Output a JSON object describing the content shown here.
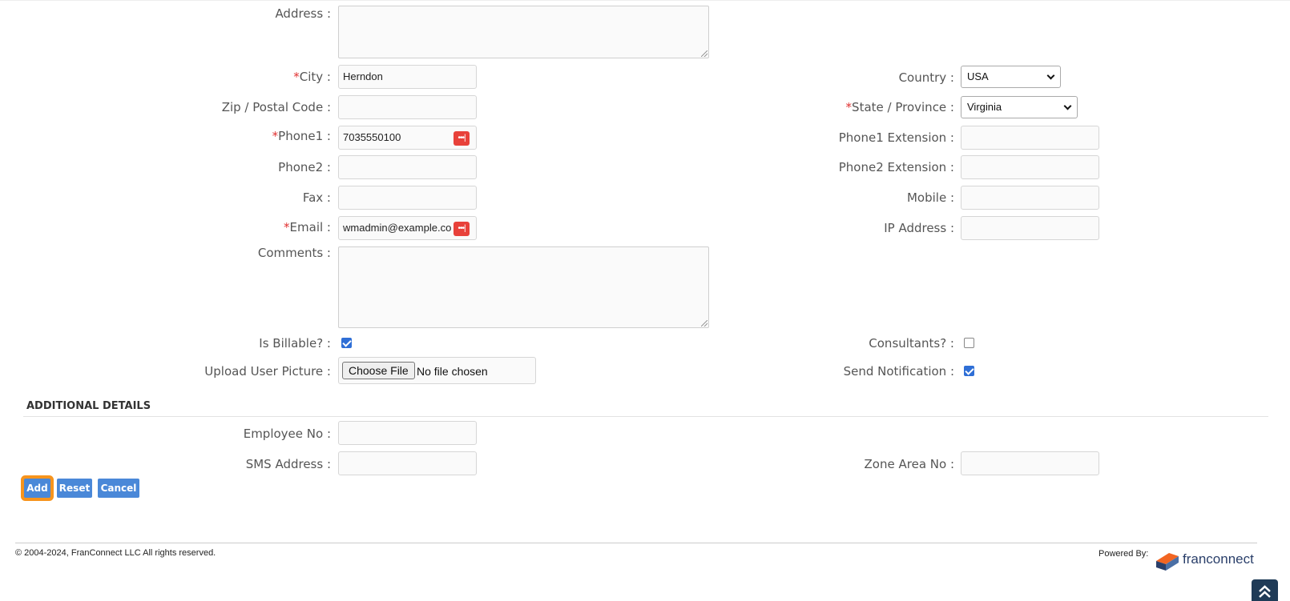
{
  "form": {
    "address": {
      "label": "Address :",
      "value": ""
    },
    "city": {
      "req": "*",
      "label": "City :",
      "value": "Herndon"
    },
    "country": {
      "label": "Country :",
      "value": "USA"
    },
    "zip": {
      "label": "Zip / Postal Code :",
      "value": ""
    },
    "state": {
      "req": "*",
      "label": "State / Province :",
      "value": "Virginia"
    },
    "phone1": {
      "req": "*",
      "label": "Phone1 :",
      "value": "7035550100"
    },
    "phone1_ext": {
      "label": "Phone1 Extension :",
      "value": ""
    },
    "phone2": {
      "label": "Phone2 :",
      "value": ""
    },
    "phone2_ext": {
      "label": "Phone2 Extension :",
      "value": ""
    },
    "fax": {
      "label": "Fax :",
      "value": ""
    },
    "mobile": {
      "label": "Mobile :",
      "value": ""
    },
    "email": {
      "req": "*",
      "label": "Email :",
      "value": "wmadmin@example.co"
    },
    "ip_address": {
      "label": "IP Address :",
      "value": ""
    },
    "comments": {
      "label": "Comments :",
      "value": ""
    },
    "is_billable": {
      "label": "Is Billable? :",
      "checked": true
    },
    "consultants": {
      "label": "Consultants? :",
      "checked": false
    },
    "upload_picture": {
      "label": "Upload User Picture :",
      "button": "Choose File",
      "status": "No file chosen"
    },
    "send_notification": {
      "label": "Send Notification :",
      "checked": true
    }
  },
  "additional": {
    "title": "ADDITIONAL DETAILS",
    "employee_no": {
      "label": "Employee No :",
      "value": ""
    },
    "sms_address": {
      "label": "SMS Address :",
      "value": ""
    },
    "zone_area_no": {
      "label": "Zone Area No :",
      "value": ""
    }
  },
  "actions": {
    "add": "Add",
    "reset": "Reset",
    "cancel": "Cancel"
  },
  "footer": {
    "copyright": "© 2004-2024, FranConnect LLC All rights reserved.",
    "powered_by": "Powered By:",
    "brand": "franconnect"
  },
  "colors": {
    "accent": "#4a88d8",
    "focus": "#f7941d",
    "required": "#e03030",
    "password_icon": "#e8413a"
  },
  "icons": {
    "password_manager": "password-manager-icon",
    "scroll_top": "double-chevron-up-icon"
  }
}
